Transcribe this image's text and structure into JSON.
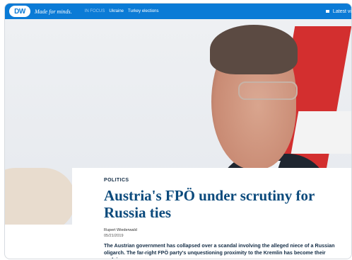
{
  "header": {
    "logo_text": "DW",
    "tagline": "Made for minds.",
    "nav": {
      "in_focus": "IN FOCUS",
      "items": [
        "Ukraine",
        "Turkey elections"
      ]
    },
    "latest_label": "Latest vi"
  },
  "article": {
    "category": "POLITICS",
    "title": "Austria's FPÖ under scrutiny for Russia ties",
    "author": "Rupert Wiederwald",
    "date": "05/21/2019",
    "summary": "The Austrian government has collapsed over a scandal involving the alleged niece of a Russian oligarch. The far-right FPÖ party's unquestioning proximity to the Kremlin has become their undoing."
  },
  "colors": {
    "brand_blue": "#0b7bd6",
    "title_blue": "#0b4a7c",
    "flag_red": "#d32f2f"
  }
}
